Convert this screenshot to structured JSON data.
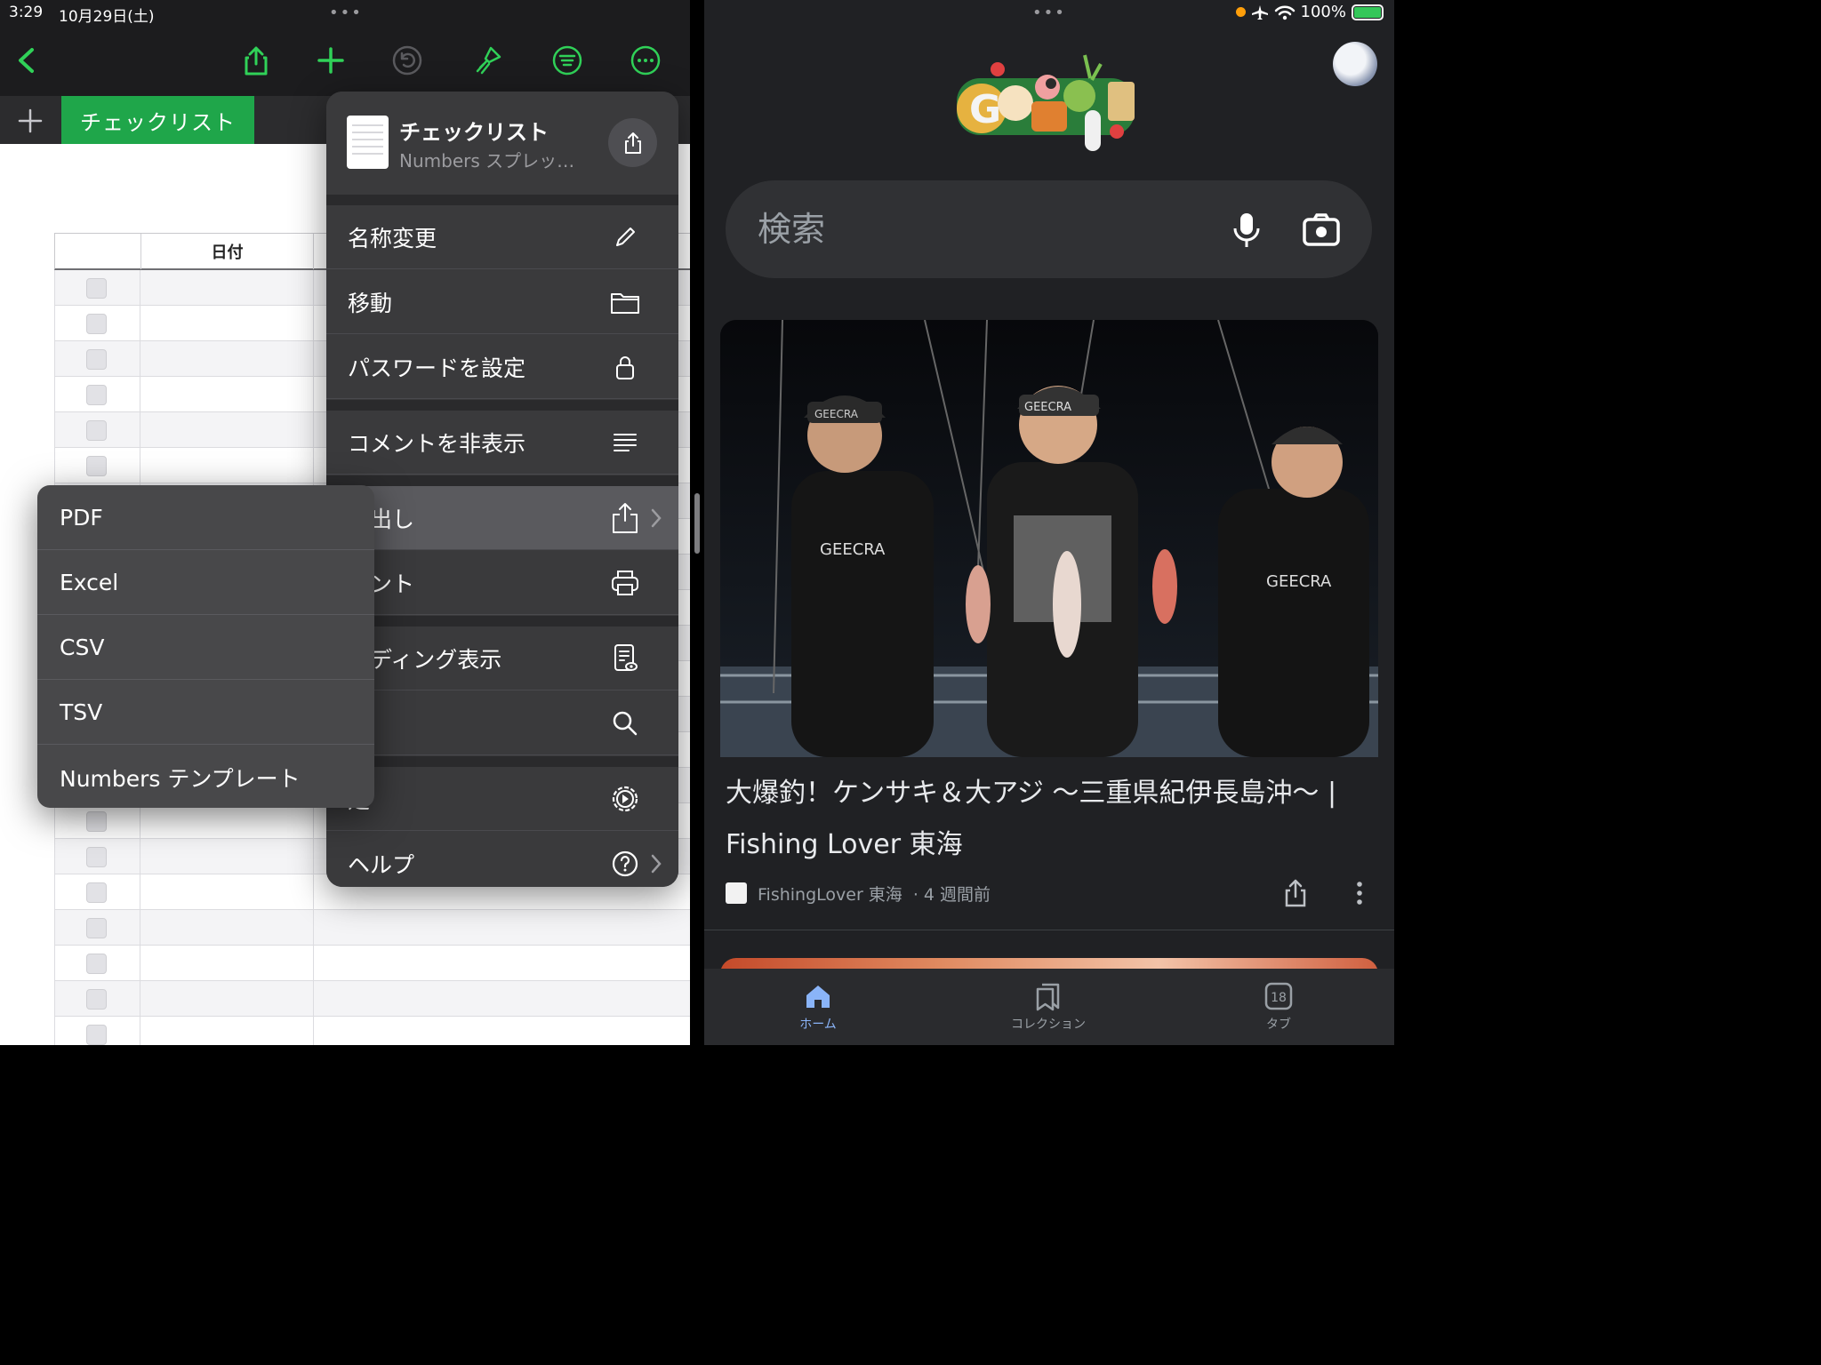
{
  "left_status": {
    "time": "3:29",
    "date": "10月29日(土)"
  },
  "sheet_tab": {
    "label": "チェックリスト"
  },
  "table": {
    "header_date": "日付"
  },
  "menu": {
    "doc_title": "チェックリスト",
    "doc_subtitle": "Numbers スプレッ…",
    "items": [
      {
        "label": "名称変更"
      },
      {
        "label": "移動"
      },
      {
        "label": "パスワードを設定"
      },
      {
        "label": "コメントを非表示"
      },
      {
        "label": "き出し"
      },
      {
        "label": "リント"
      },
      {
        "label": "ーディング表示"
      },
      {
        "label": "索"
      },
      {
        "label": "定"
      },
      {
        "label": "ヘルプ"
      }
    ]
  },
  "submenu": {
    "items": [
      {
        "label": "PDF"
      },
      {
        "label": "Excel"
      },
      {
        "label": "CSV"
      },
      {
        "label": "TSV"
      },
      {
        "label": "Numbers テンプレート"
      }
    ]
  },
  "right_status": {
    "battery": "100%"
  },
  "search": {
    "placeholder": "検索"
  },
  "card": {
    "title": "大爆釣！ケンサキ＆大アジ 〜三重県紀伊長島沖〜 | Fishing Lover 東海",
    "source": "FishingLover 東海",
    "age": "· 4 週間前",
    "cap_1": "GEECRA",
    "cap_2": "GEECRA",
    "cap_3": "GEECRA",
    "shirt_1": "GEECRA",
    "shirt_3": "GEECRA"
  },
  "bottom_nav": {
    "home": "ホーム",
    "collections": "コレクション",
    "tabs": "タブ",
    "tab_count": "18"
  },
  "colors": {
    "numbers_green": "#1fa64a",
    "google_blue": "#8ab4f8",
    "menu_bg": "#3a3a3c"
  }
}
